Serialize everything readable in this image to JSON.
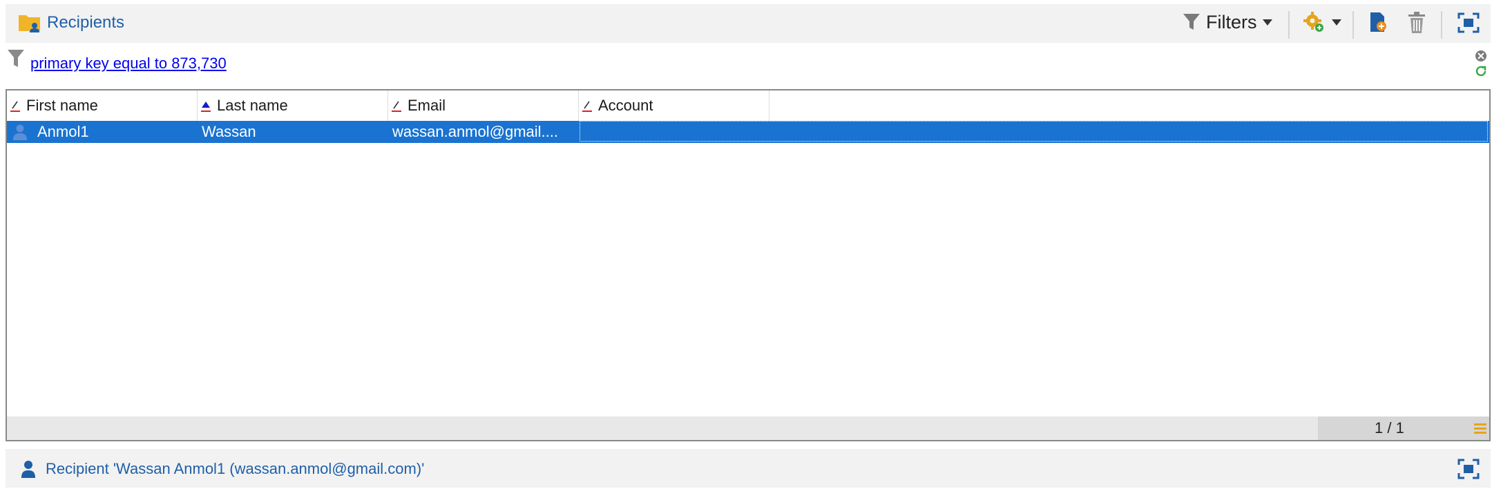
{
  "header": {
    "title": "Recipients",
    "filters_label": "Filters"
  },
  "filter": {
    "text": "primary key equal to 873,730"
  },
  "grid": {
    "columns": [
      {
        "label": "First name",
        "sort": "none"
      },
      {
        "label": "Last name",
        "sort": "ascending"
      },
      {
        "label": "Email",
        "sort": "none"
      },
      {
        "label": "Account",
        "sort": "none"
      }
    ],
    "rows": [
      {
        "first_name": "Anmol1",
        "last_name": "Wassan",
        "email": "wassan.anmol@gmail....",
        "account": ""
      }
    ],
    "pager": "1 / 1"
  },
  "footer": {
    "detail_label": "Recipient 'Wassan Anmol1 (wassan.anmol@gmail.com)'"
  },
  "colors": {
    "accent_blue": "#1f5fa8",
    "selection": "#1a73d0",
    "link": "#0000ee"
  },
  "icons": [
    "folder-recipients-icon",
    "funnel-icon",
    "settings-gear-icon",
    "new-recipient-icon",
    "trash-icon",
    "maximize-icon",
    "clear-filter-icon",
    "refresh-icon",
    "sort-ascending-icon",
    "text-column-icon",
    "user-icon",
    "menu-icon"
  ]
}
